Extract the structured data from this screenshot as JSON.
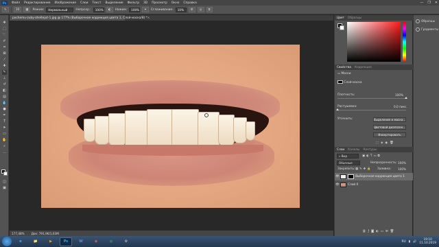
{
  "menu": {
    "logo": "Ps",
    "items": [
      "Файл",
      "Редактирование",
      "Изображение",
      "Слои",
      "Текст",
      "Выделение",
      "Фильтр",
      "3D",
      "Просмотр",
      "Окно",
      "Справка"
    ],
    "window_controls": [
      "—",
      "❐",
      "✕"
    ]
  },
  "options_bar": {
    "brush_size": "10",
    "mode_label": "Режим:",
    "mode_value": "Нормальный",
    "opacity_label": "Непрозр.:",
    "opacity_value": "100%",
    "flow_label": "Нажим:",
    "flow_value": "100%",
    "smoothing_label": "Сглаживание:",
    "smoothing_value": "10%"
  },
  "document_tab": {
    "title": "pochemu-zuby-zheltejut-1.jpg @ 177% (Выборочная коррекция цвета 1, Слой-маска/8) *",
    "close": "×"
  },
  "status_bar": {
    "zoom": "177,48%",
    "doc": "Док: 791,9K/1,63M"
  },
  "color_panel": {
    "tabs": [
      "Цвет",
      "Образцы"
    ]
  },
  "properties_panel": {
    "tabs": [
      "Свойства",
      "Коррекция"
    ],
    "mask_label": "Маски",
    "layer_mask_label": "Слой-маска",
    "density_label": "Плотность:",
    "density_value": "100%",
    "feather_label": "Растушевка:",
    "feather_value": "0,0 пикс.",
    "refine_label": "Уточнить:",
    "btn_select_mask": "Выделение и маска...",
    "btn_color_range": "Цветовой диапазон...",
    "btn_invert": "Инвертировать"
  },
  "layers_panel": {
    "tabs": [
      "Слои",
      "Каналы",
      "Контуры"
    ],
    "kind_filter": "Вид",
    "blend_mode": "Обычные",
    "opacity_label": "Непрозрачность:",
    "opacity_value": "100%",
    "lock_label": "Закрепить:",
    "fill_label": "Заливка:",
    "fill_value": "100%",
    "layers": [
      {
        "name": "Выборочная коррекция цвета 1",
        "selected": true
      },
      {
        "name": "Слой 0",
        "selected": false
      }
    ]
  },
  "dock": {
    "items": [
      "Образцы",
      "Градиенты"
    ]
  },
  "taskbar": {
    "apps": [
      "e",
      "📁",
      "▶",
      "Ps",
      "W",
      "◉",
      "◎",
      "⚙"
    ],
    "tray_lang": "RU",
    "time": "19:10",
    "date": "11.10.2019"
  },
  "colors": {
    "accent": "#31a8ff",
    "panel": "#535353",
    "canvas_bg": "#282828"
  }
}
